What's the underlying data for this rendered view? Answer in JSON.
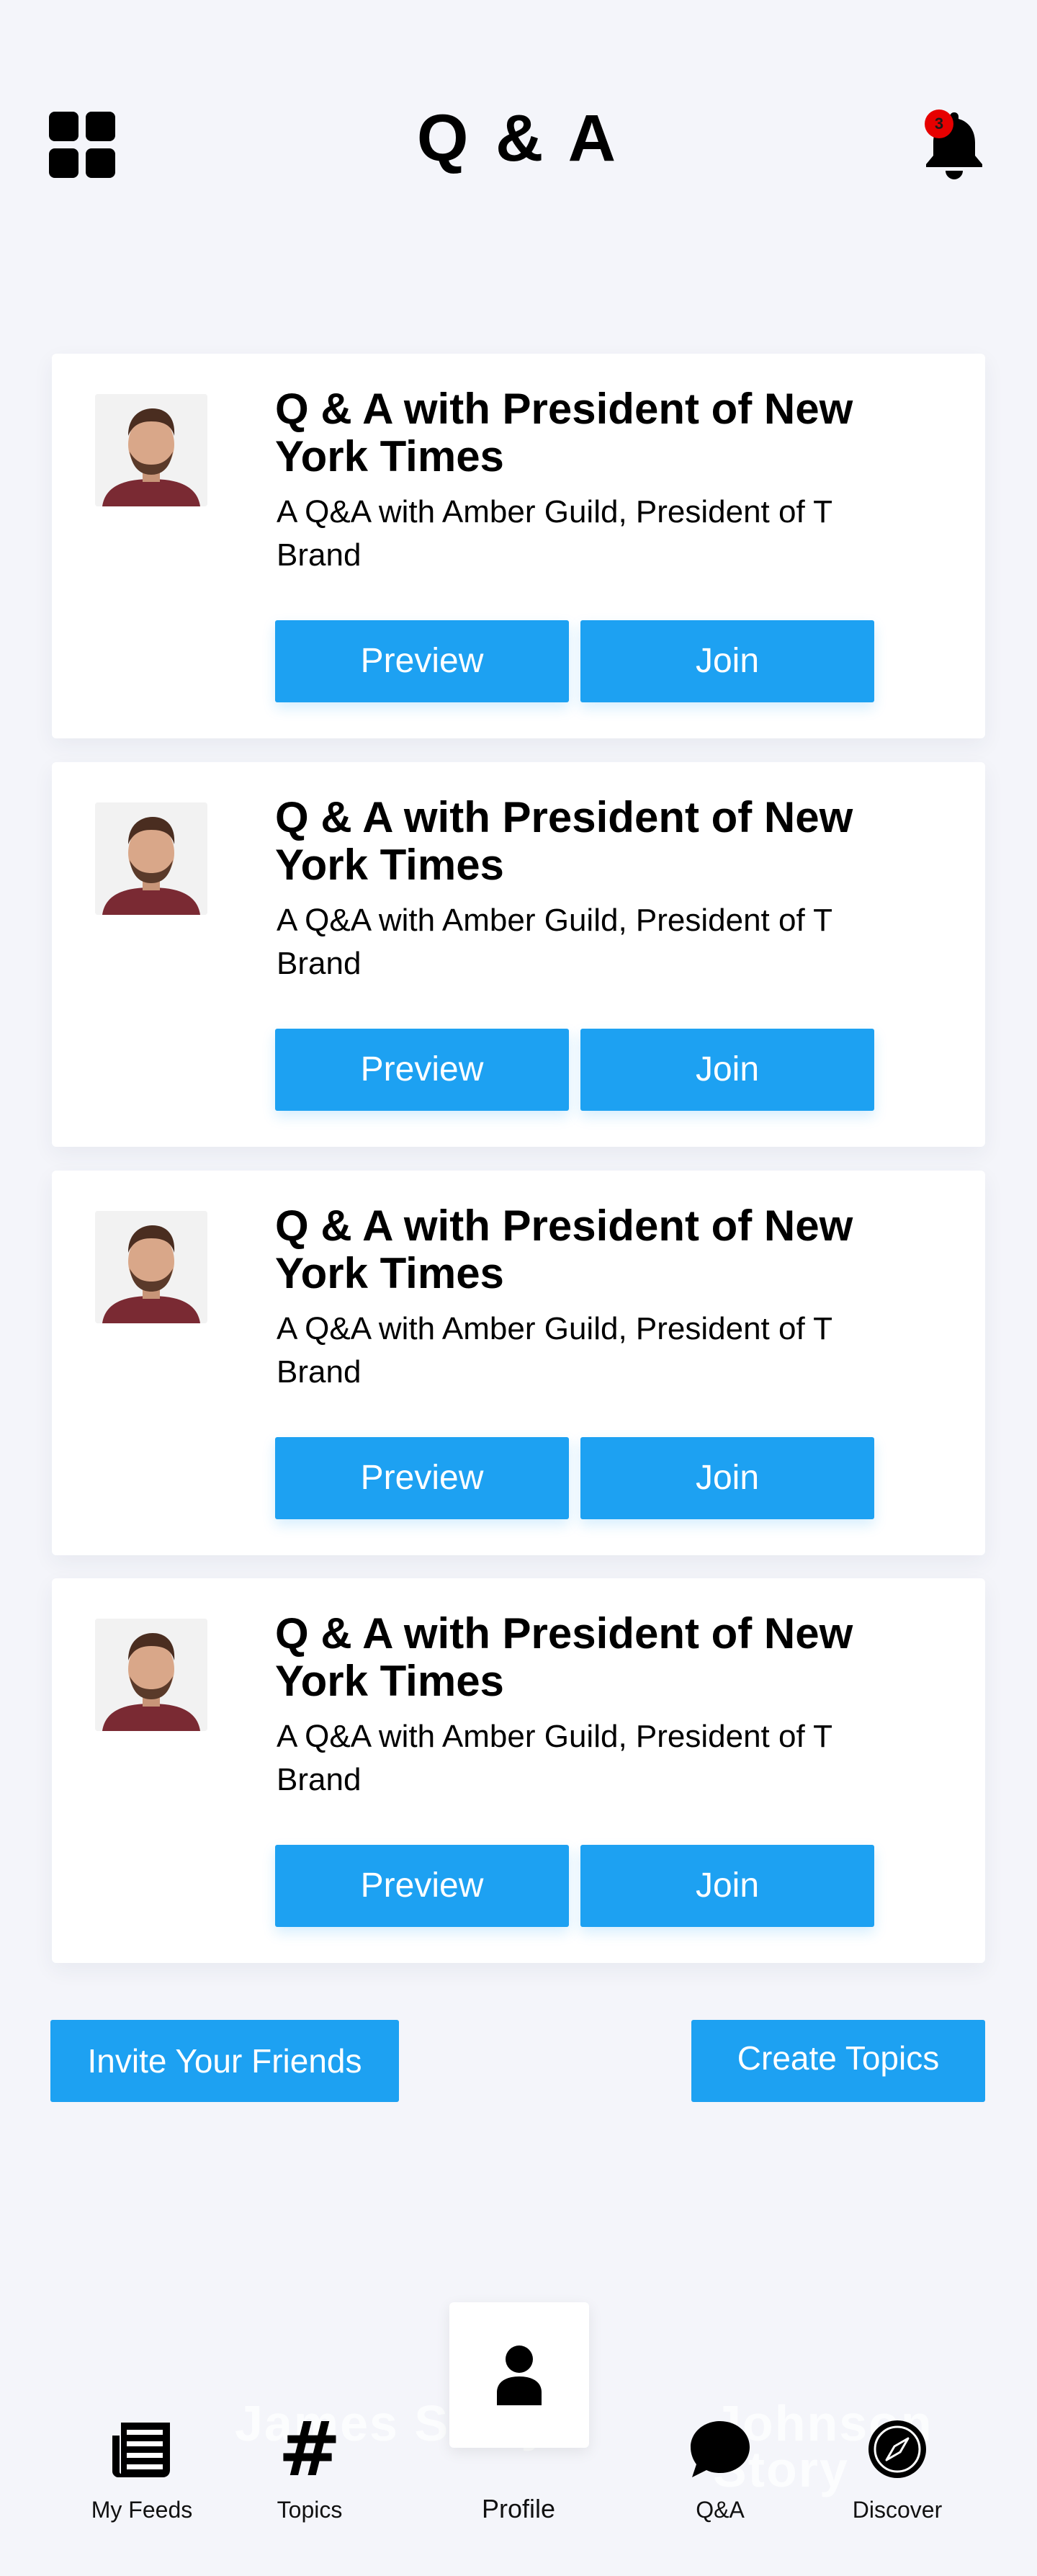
{
  "header": {
    "title": "Q & A",
    "menu_icon": "grid-icon",
    "notification_icon": "bell-icon",
    "notification_count": "3"
  },
  "cards": [
    {
      "title": "Q & A with President of New York Times",
      "description": "A Q&A with Amber Guild, President of T Brand",
      "preview_label": "Preview",
      "join_label": "Join"
    },
    {
      "title": "Q & A with President of New York Times",
      "description": "A Q&A with Amber Guild, President of T Brand",
      "preview_label": "Preview",
      "join_label": "Join"
    },
    {
      "title": "Q & A with President of New York Times",
      "description": "A Q&A with Amber Guild, President of T Brand",
      "preview_label": "Preview",
      "join_label": "Join"
    },
    {
      "title": "Q & A with President of New York Times",
      "description": "A Q&A with Amber Guild, President of T Brand",
      "preview_label": "Preview",
      "join_label": "Join"
    }
  ],
  "actions": {
    "invite_label": "Invite Your Friends",
    "create_label": "Create Topics"
  },
  "nav": {
    "items": [
      {
        "label": "My Feeds",
        "icon": "newspaper-icon"
      },
      {
        "label": "Topics",
        "icon": "hashtag-icon"
      },
      {
        "label": "Profile",
        "icon": "person-icon"
      },
      {
        "label": "Q&A",
        "icon": "chat-bubble-icon"
      },
      {
        "label": "Discover",
        "icon": "compass-icon"
      }
    ],
    "ghost_left": "James Story",
    "ghost_right": "Johnson Story"
  },
  "colors": {
    "accent": "#1da1f2",
    "background": "#f4f5fa",
    "badge": "#e60000"
  }
}
